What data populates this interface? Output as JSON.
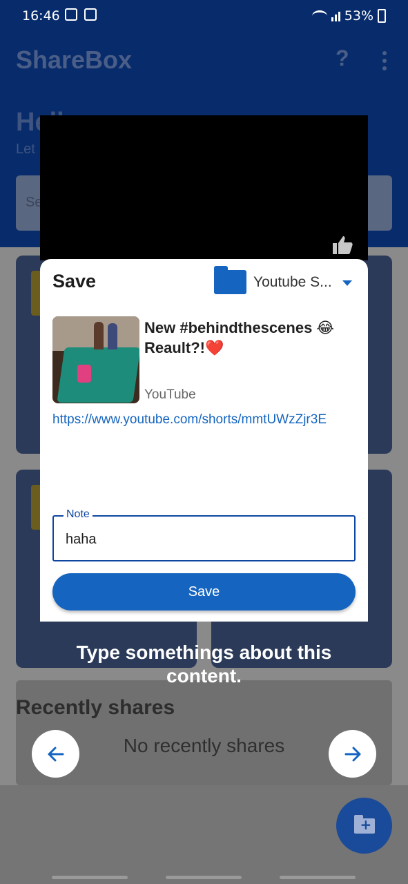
{
  "status_bar": {
    "time": "16:46",
    "battery": "53%"
  },
  "app": {
    "title": "ShareBox",
    "help": "?",
    "greeting": "Hell",
    "greeting_sub": "Let",
    "search_placeholder": "Se",
    "recent_title": "Recently shares",
    "recent_empty": "No recently shares"
  },
  "dialog": {
    "title": "Save",
    "folder": "Youtube S...",
    "item": {
      "title": "New #behindthescenes 😂 Reault?!❤️",
      "source": "YouTube",
      "url": "https://www.youtube.com/shorts/mmtUWzZjr3E"
    },
    "note": {
      "label": "Note",
      "value": "haha"
    },
    "save_label": "Save"
  },
  "tutorial": {
    "tip": "Type somethings about this content."
  },
  "colors": {
    "primary": "#1565c0",
    "header": "#082c6b"
  },
  "icons": [
    "folder-icon",
    "dropdown-icon",
    "thumb-up-icon",
    "arrow-left-icon",
    "arrow-right-icon",
    "add-folder-icon",
    "more-vert-icon",
    "help-icon"
  ]
}
